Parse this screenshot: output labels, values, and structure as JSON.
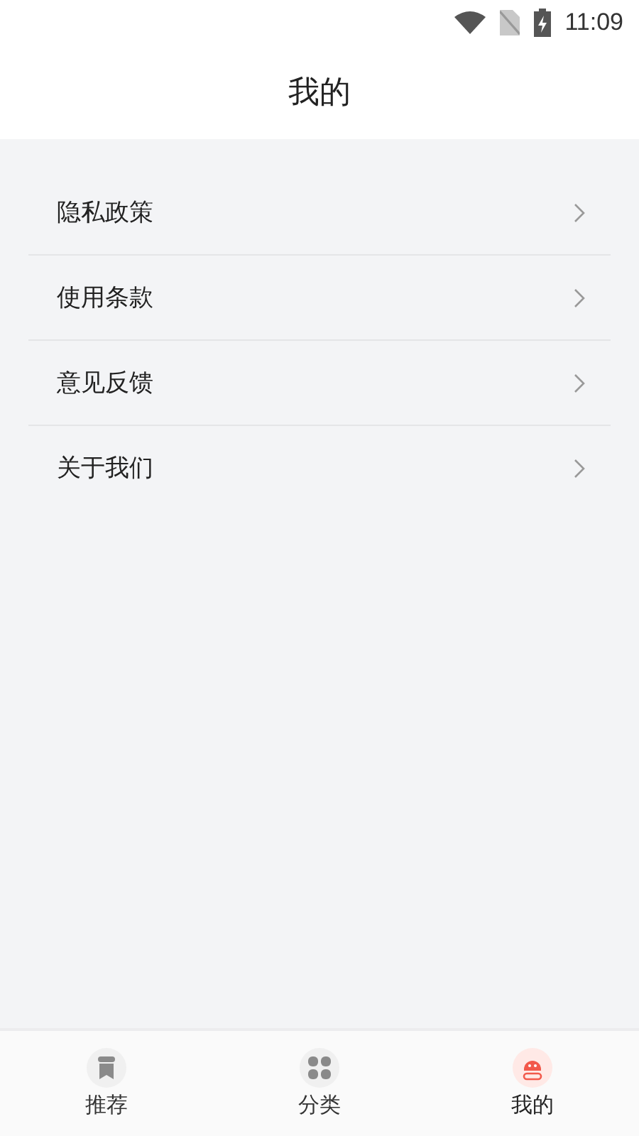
{
  "status_bar": {
    "time": "11:09"
  },
  "header": {
    "title": "我的"
  },
  "menu": [
    {
      "label": "隐私政策"
    },
    {
      "label": "使用条款"
    },
    {
      "label": "意见反馈"
    },
    {
      "label": "关于我们"
    }
  ],
  "tabs": [
    {
      "label": "推荐",
      "kind": "bookmark",
      "selected": false
    },
    {
      "label": "分类",
      "kind": "grid",
      "selected": false
    },
    {
      "label": "我的",
      "kind": "robot",
      "selected": true
    }
  ]
}
